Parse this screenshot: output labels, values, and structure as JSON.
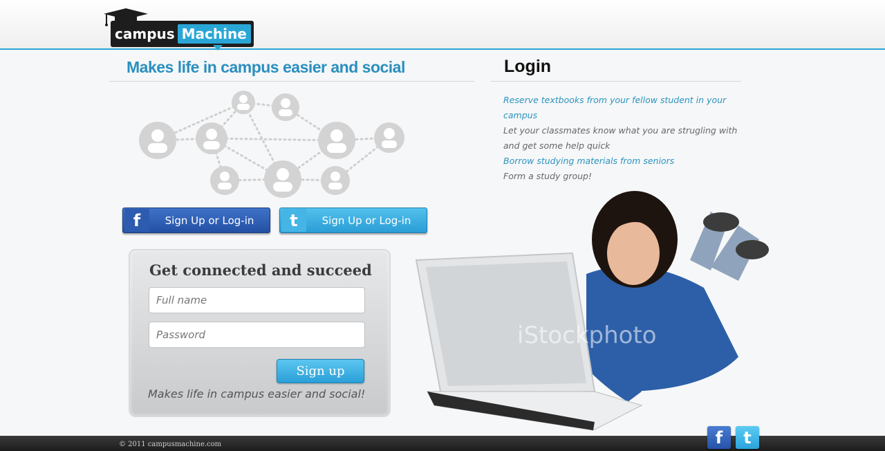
{
  "header": {
    "logo_word1": "campus",
    "logo_word2": "Machine"
  },
  "hero": {
    "tagline": "Makes life in campus easier and social"
  },
  "login": {
    "title": "Login"
  },
  "features": [
    {
      "text": "Reserve textbooks from your fellow student in your campus",
      "style": "blue"
    },
    {
      "text": "Let your classmates know what you are strugling with and get some help quick",
      "style": "gray"
    },
    {
      "text": "Borrow studying materials from seniors",
      "style": "blue"
    },
    {
      "text": "Form a study group!",
      "style": "gray"
    }
  ],
  "social": {
    "facebook_label": "Sign Up or Log-in",
    "twitter_label": "Sign Up or Log-in",
    "facebook_icon": "f",
    "twitter_icon": "t"
  },
  "signup": {
    "title": "Get connected and succeed",
    "fullname_placeholder": "Full name",
    "password_placeholder": "Password",
    "submit_label": "Sign up",
    "footer_text": "Makes life in campus easier and social!"
  },
  "image": {
    "watermark": "iStockphoto"
  },
  "footer": {
    "copyright": "© 2011 campusmachine.com",
    "facebook_icon": "f",
    "twitter_icon": "t"
  },
  "colors": {
    "accent": "#2aa6d6",
    "tagline": "#2a8fbf",
    "facebook": "#2d5bb0",
    "twitter": "#45b5e6"
  }
}
